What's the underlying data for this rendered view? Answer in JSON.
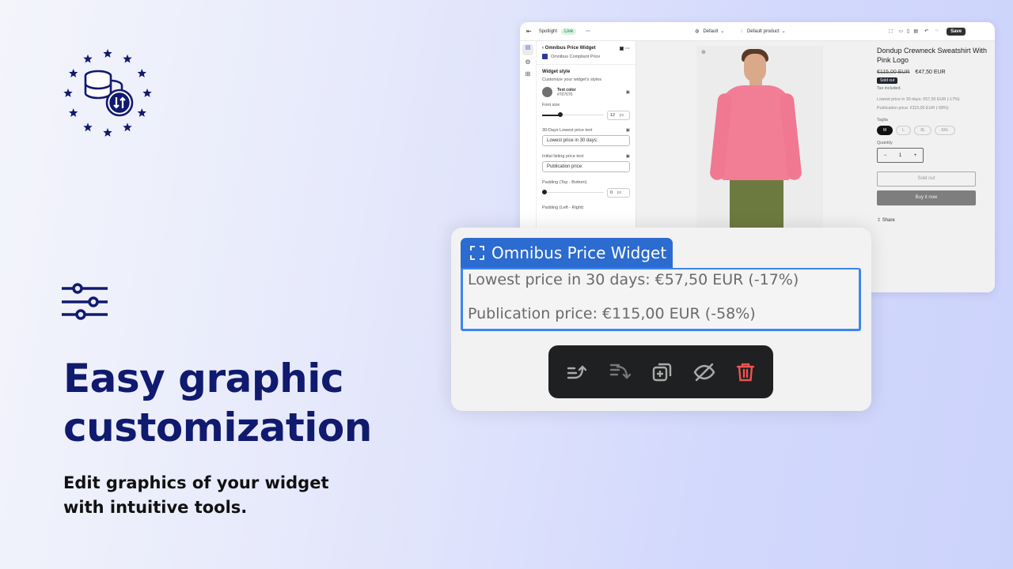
{
  "hero": {
    "title_line1": "Easy graphic",
    "title_line2": "customization",
    "subtitle_line1": "Edit graphics of your widget",
    "subtitle_line2": "with intuitive tools.",
    "accent": "#101a6e"
  },
  "editor": {
    "topbar": {
      "app": "Spotlight",
      "status": "Live",
      "more": "···",
      "theme": "Default",
      "template": "Default product",
      "save": "Save"
    },
    "panel": {
      "back_title": "Omnibus Price Widget",
      "app_name": "Omnibus Compliant Price",
      "section": "Widget style",
      "section_desc": "Customize your widget's styles",
      "text_color_label": "Text color",
      "text_color_value": "#707070",
      "font_size_label": "Font size",
      "font_size_value": "12",
      "unit": "px",
      "lowest_label": "30-Days Lowest price text",
      "lowest_value": "Lowest price in 30 days:",
      "initial_label": "Initial listing price text",
      "initial_value": "Publication price:",
      "pad_tb_label": "Padding (Top - Bottom)",
      "pad_tb_value": "0",
      "pad_lr_label": "Padding (Left - Right)"
    },
    "product": {
      "title": "Dondup Crewneck Sweatshirt With Pink Logo",
      "old_price": "€115,00 EUR",
      "price": "€47,50 EUR",
      "badge": "Sold out",
      "tax": "Tax included.",
      "lowest": "Lowest price in 30 days: €57,50 EUR (-17%)",
      "publication": "Publication price: €115,00 EUR (-58%)",
      "size_label": "Taglia",
      "sizes": [
        "M",
        "L",
        "XL",
        "XXL"
      ],
      "qty_label": "Quantity",
      "qty": "1",
      "minus": "−",
      "plus": "+",
      "sold_out_btn": "Sold out",
      "buy_btn": "Buy it now",
      "share": "Share"
    }
  },
  "widget": {
    "tab_label": "Omnibus Price Widget",
    "line1": "Lowest price in 30 days: €57,50 EUR (-17%)",
    "line2": "Publication price: €115,00 EUR (-58%)"
  },
  "toolbar_icons": [
    "move-up-icon",
    "move-down-icon",
    "duplicate-icon",
    "hide-icon",
    "delete-icon"
  ],
  "colors": {
    "widget_tab": "#2c6bcf",
    "widget_border": "#3c85f0",
    "delete": "#ef5350",
    "toolbar_bg": "#1f2021"
  }
}
